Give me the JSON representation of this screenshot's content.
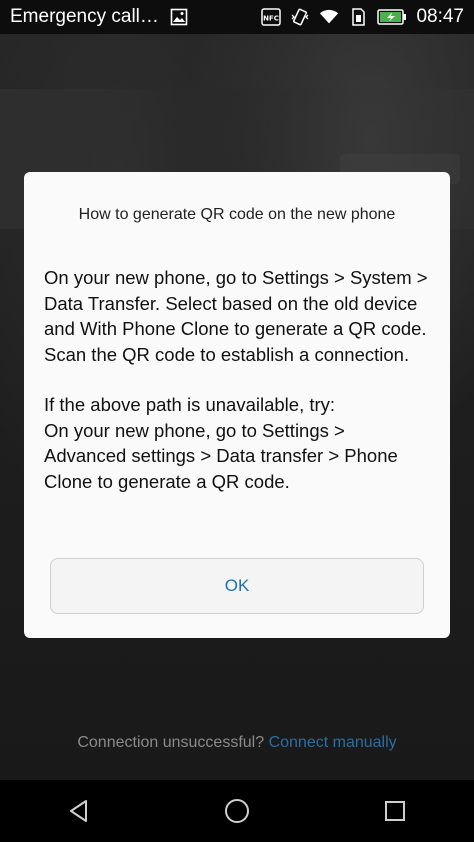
{
  "status_bar": {
    "title": "Emergency call…",
    "time": "08:47",
    "icons": [
      "image-icon",
      "nfc-icon",
      "vibrate-icon",
      "wifi-icon",
      "sim-icon",
      "battery-charging-icon"
    ]
  },
  "dialog": {
    "title": "How to generate QR code on the new phone",
    "paragraph_1": "On your new phone, go to Settings > System > Data Transfer. Select based on the old device and With Phone Clone to generate a QR code. Scan the QR code to establish a connection.",
    "paragraph_2_line_1": "If the above path is unavailable, try:",
    "paragraph_2_line_2": "On your new phone, go to Settings > Advanced settings > Data transfer > Phone Clone to generate a QR code.",
    "ok_label": "OK"
  },
  "footer": {
    "hint_text": "Connection unsuccessful?",
    "link_text": "Connect manually"
  },
  "nav_bar": {
    "icons": [
      "back-icon",
      "home-icon",
      "recents-icon"
    ]
  },
  "colors": {
    "accent": "#1e6fb5",
    "link": "#2b6ea3",
    "battery": "#4caf50"
  }
}
